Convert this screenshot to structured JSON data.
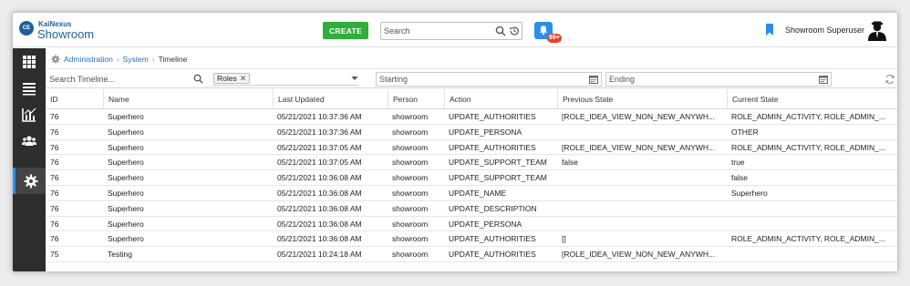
{
  "header": {
    "logo_text": "CE",
    "brand_line1": "KaiNexus",
    "brand_line2": "Showroom",
    "create_label": "CREATE",
    "search_placeholder": "Search",
    "notification_count": "99+",
    "username": "Showroom Superuser"
  },
  "sidebar": {
    "items": [
      {
        "icon": "grid-icon"
      },
      {
        "icon": "list-icon"
      },
      {
        "icon": "chart-icon"
      },
      {
        "icon": "users-icon"
      },
      {
        "icon": "gear-icon",
        "active": true
      }
    ]
  },
  "breadcrumb": {
    "items": [
      "Administration",
      "System",
      "Timeline"
    ]
  },
  "filters": {
    "search_placeholder": "Search Timeline...",
    "roles_chip": "Roles",
    "starting_placeholder": "Starting",
    "ending_placeholder": "Ending"
  },
  "table": {
    "columns": [
      "ID",
      "Name",
      "Last Updated",
      "Person",
      "Action",
      "Previous State",
      "Current State"
    ],
    "rows": [
      [
        "76",
        "Superhero",
        "05/21/2021 10:37:36 AM",
        "showroom",
        "UPDATE_AUTHORITIES",
        "[ROLE_IDEA_VIEW_NON_NEW_ANYWH...",
        "ROLE_ADMIN_ACTIVITY, ROLE_ADMIN_..."
      ],
      [
        "76",
        "Superhero",
        "05/21/2021 10:37:36 AM",
        "showroom",
        "UPDATE_PERSONA",
        "",
        "OTHER"
      ],
      [
        "76",
        "Superhero",
        "05/21/2021 10:37:05 AM",
        "showroom",
        "UPDATE_AUTHORITIES",
        "[ROLE_IDEA_VIEW_NON_NEW_ANYWH...",
        "ROLE_ADMIN_ACTIVITY, ROLE_ADMIN_..."
      ],
      [
        "76",
        "Superhero",
        "05/21/2021 10:37:05 AM",
        "showroom",
        "UPDATE_SUPPORT_TEAM",
        "false",
        "true"
      ],
      [
        "76",
        "Superhero",
        "05/21/2021 10:36:08 AM",
        "showroom",
        "UPDATE_SUPPORT_TEAM",
        "",
        "false"
      ],
      [
        "76",
        "Superhero",
        "05/21/2021 10:36:08 AM",
        "showroom",
        "UPDATE_NAME",
        "",
        "Superhero"
      ],
      [
        "76",
        "Superhero",
        "05/21/2021 10:36:08 AM",
        "showroom",
        "UPDATE_DESCRIPTION",
        "",
        ""
      ],
      [
        "76",
        "Superhero",
        "05/21/2021 10:36:08 AM",
        "showroom",
        "UPDATE_PERSONA",
        "",
        ""
      ],
      [
        "76",
        "Superhero",
        "05/21/2021 10:36:08 AM",
        "showroom",
        "UPDATE_AUTHORITIES",
        "[]",
        "ROLE_ADMIN_ACTIVITY, ROLE_ADMIN_..."
      ],
      [
        "75",
        "Testing",
        "05/21/2021 10:24:18 AM",
        "showroom",
        "UPDATE_AUTHORITIES",
        "[ROLE_IDEA_VIEW_NON_NEW_ANYWH...",
        ""
      ]
    ]
  },
  "colors": {
    "create_green": "#2fae3a",
    "accent_blue": "#2b8ee8",
    "brand_blue": "#1f5f9a",
    "badge_red": "#e2432d",
    "sidebar_dark": "#2d2d2d"
  }
}
